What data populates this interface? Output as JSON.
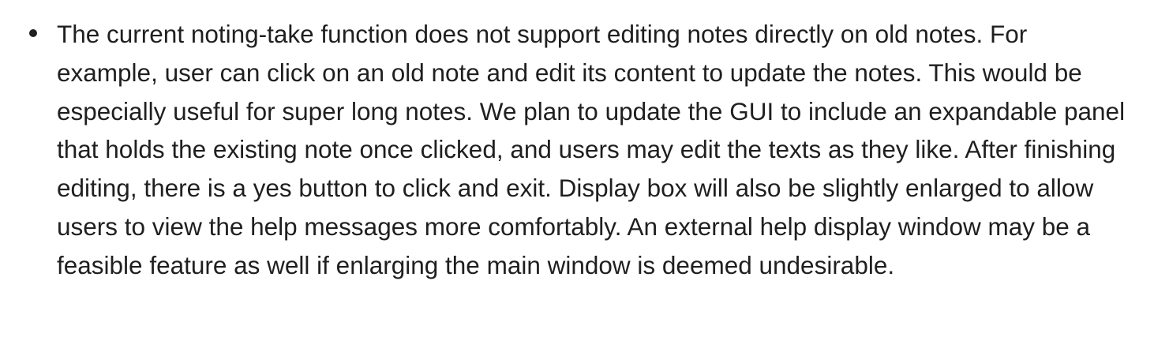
{
  "document": {
    "items": [
      {
        "text": "The current noting-take function does not support editing notes directly on old notes. For example, user can click on an old note and edit its content to update the notes. This would be especially useful for super long notes. We plan to update the GUI to include an expandable panel that holds the existing note once clicked, and users may edit the texts as they like. After finishing editing, there is a yes button to click and exit. Display box will also be slightly enlarged to allow users to view the help messages more comfortably. An external help display window may be a feasible feature as well if enlarging the main window is deemed undesirable."
      }
    ]
  }
}
